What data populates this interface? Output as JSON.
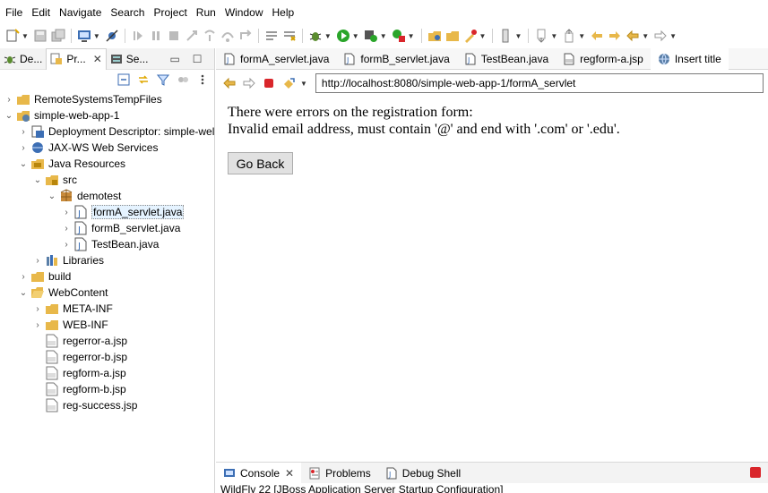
{
  "menu": [
    "File",
    "Edit",
    "Navigate",
    "Search",
    "Project",
    "Run",
    "Window",
    "Help"
  ],
  "left_tabs": [
    {
      "label": "De..."
    },
    {
      "label": "Pr...",
      "active": true,
      "close": "✕"
    },
    {
      "label": "Se..."
    }
  ],
  "tree": [
    {
      "label": "RemoteSystemsTempFiles",
      "icon": "folder-project-icon",
      "level": 0,
      "twist": "›"
    },
    {
      "label": "simple-web-app-1",
      "icon": "web-project-icon",
      "level": 0,
      "twist": "⌄"
    },
    {
      "label": "Deployment Descriptor: simple-wel",
      "icon": "deployment-descriptor-icon",
      "level": 1,
      "twist": "›"
    },
    {
      "label": "JAX-WS Web Services",
      "icon": "web-services-icon",
      "level": 1,
      "twist": "›"
    },
    {
      "label": "Java Resources",
      "icon": "java-resources-icon",
      "level": 1,
      "twist": "⌄"
    },
    {
      "label": "src",
      "icon": "source-folder-icon",
      "level": 2,
      "twist": "⌄"
    },
    {
      "label": "demotest",
      "icon": "package-icon",
      "level": 3,
      "twist": "⌄"
    },
    {
      "label": "formA_servlet.java",
      "icon": "java-file-icon",
      "level": 4,
      "twist": "›",
      "selected": true
    },
    {
      "label": "formB_servlet.java",
      "icon": "java-file-icon",
      "level": 4,
      "twist": "›"
    },
    {
      "label": "TestBean.java",
      "icon": "java-file-icon",
      "level": 4,
      "twist": "›"
    },
    {
      "label": "Libraries",
      "icon": "libraries-icon",
      "level": 2,
      "twist": "›"
    },
    {
      "label": "build",
      "icon": "folder-icon",
      "level": 1,
      "twist": "›"
    },
    {
      "label": "WebContent",
      "icon": "folder-open-icon",
      "level": 1,
      "twist": "⌄"
    },
    {
      "label": "META-INF",
      "icon": "folder-icon",
      "level": 2,
      "twist": "›"
    },
    {
      "label": "WEB-INF",
      "icon": "folder-icon",
      "level": 2,
      "twist": "›"
    },
    {
      "label": "regerror-a.jsp",
      "icon": "jsp-file-icon",
      "level": 2,
      "twist": ""
    },
    {
      "label": "regerror-b.jsp",
      "icon": "jsp-file-icon",
      "level": 2,
      "twist": ""
    },
    {
      "label": "regform-a.jsp",
      "icon": "jsp-file-icon",
      "level": 2,
      "twist": ""
    },
    {
      "label": "regform-b.jsp",
      "icon": "jsp-file-icon",
      "level": 2,
      "twist": ""
    },
    {
      "label": "reg-success.jsp",
      "icon": "jsp-file-icon",
      "level": 2,
      "twist": ""
    }
  ],
  "editor_tabs": [
    {
      "label": "formA_servlet.java",
      "icon": "java-file-icon"
    },
    {
      "label": "formB_servlet.java",
      "icon": "java-file-icon"
    },
    {
      "label": "TestBean.java",
      "icon": "java-file-icon"
    },
    {
      "label": "regform-a.jsp",
      "icon": "jsp-file-icon"
    },
    {
      "label": "Insert title",
      "icon": "globe-icon",
      "active": true
    }
  ],
  "browser": {
    "url": "http://localhost:8080/simple-web-app-1/formA_servlet"
  },
  "page": {
    "line1": "There were errors on the registration form:",
    "line2": "Invalid email address, must contain '@' and end with '.com' or '.edu'.",
    "go_back_label": "Go Back"
  },
  "bottom_tabs": [
    {
      "label": "Console",
      "active": true,
      "close": "✕",
      "icon": "console-icon"
    },
    {
      "label": "Problems",
      "icon": "problems-icon"
    },
    {
      "label": "Debug Shell",
      "icon": "debug-shell-icon"
    }
  ],
  "console_description": "WildFly 22 [JBoss Application Server Startup Configuration]",
  "colors": {
    "accent_blue": "#3c6eb4",
    "folder": "#e8b84a",
    "stop_red": "#d9262b",
    "run_green": "#2aa52a"
  }
}
